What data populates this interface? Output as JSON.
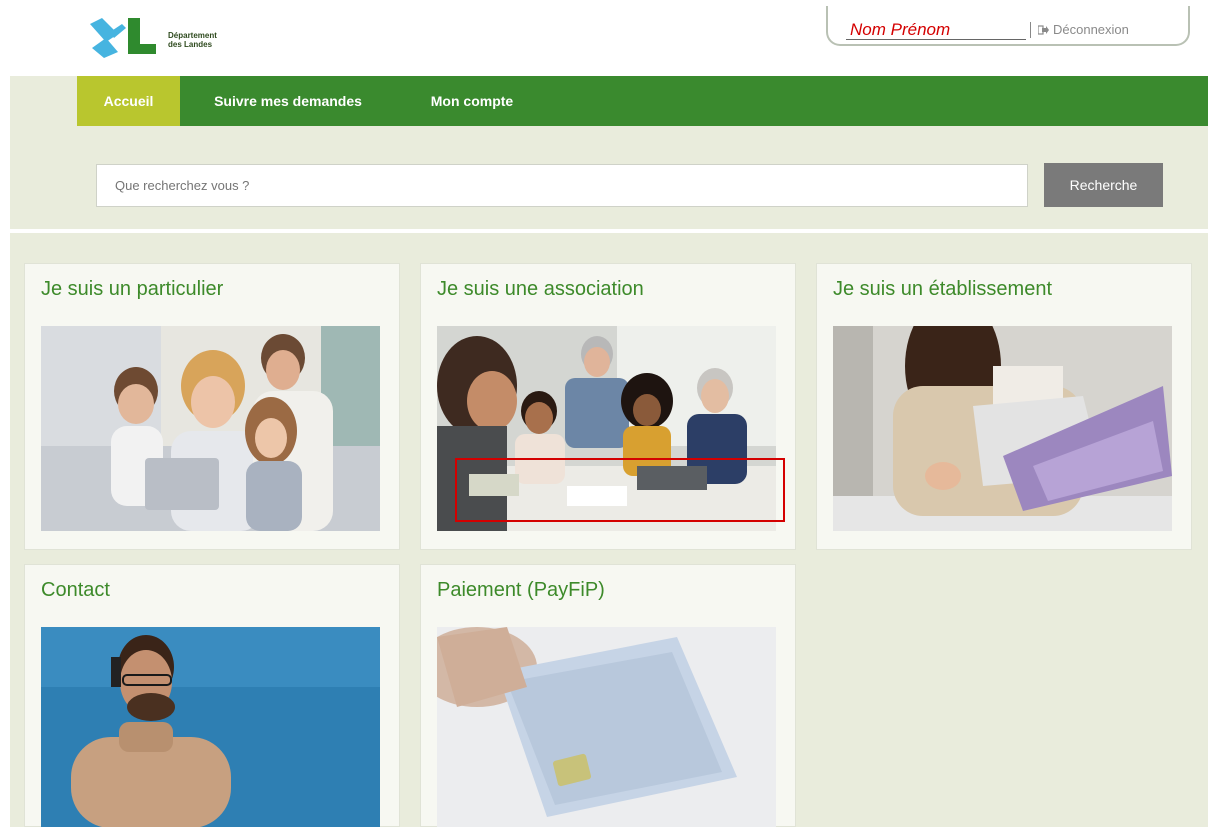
{
  "header": {
    "logo_text_line1": "Département",
    "logo_text_line2": "des Landes",
    "user_name": "Nom Prénom",
    "logout_label": "Déconnexion"
  },
  "nav": {
    "items": [
      {
        "label": "Accueil",
        "active": true
      },
      {
        "label": "Suivre mes demandes",
        "active": false
      },
      {
        "label": "Mon compte",
        "active": false
      }
    ]
  },
  "search": {
    "placeholder": "Que recherchez vous ?",
    "button_label": "Recherche"
  },
  "cards": [
    {
      "title": "Je suis un particulier",
      "image": "family-with-tablet"
    },
    {
      "title": "Je suis une association",
      "image": "team-meeting"
    },
    {
      "title": "Je suis un établissement",
      "image": "woman-with-documents"
    },
    {
      "title": "Contact",
      "image": "man-on-phone"
    },
    {
      "title": "Paiement (PayFiP)",
      "image": "credit-card"
    }
  ],
  "colors": {
    "nav_green": "#3a8a2e",
    "nav_active": "#b9c62e",
    "band_bg": "#e9ecdc",
    "title_green": "#3d8a2a",
    "annotation_red": "#d40000"
  }
}
